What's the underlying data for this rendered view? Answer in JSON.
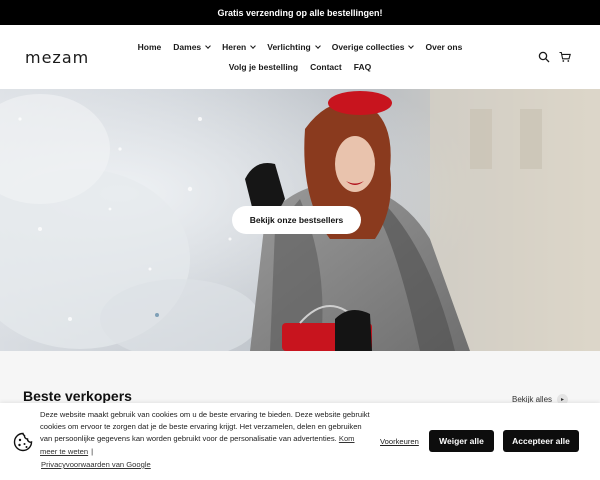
{
  "announcement": "Gratis verzending op alle bestellingen!",
  "header": {
    "logo": "mezam",
    "nav_row1": [
      {
        "label": "Home",
        "has_chevron": false
      },
      {
        "label": "Dames",
        "has_chevron": true
      },
      {
        "label": "Heren",
        "has_chevron": true
      },
      {
        "label": "Verlichting",
        "has_chevron": true
      },
      {
        "label": "Overige collecties",
        "has_chevron": true
      },
      {
        "label": "Over ons",
        "has_chevron": false
      }
    ],
    "nav_row2": [
      {
        "label": "Volg je bestelling"
      },
      {
        "label": "Contact"
      },
      {
        "label": "FAQ"
      }
    ],
    "icons": [
      "search-icon",
      "cart-icon"
    ]
  },
  "hero": {
    "cta_label": "Bekijk onze bestsellers"
  },
  "bestsellers": {
    "title": "Beste verkopers",
    "view_all": "Bekijk alles"
  },
  "cookie": {
    "text": "Deze website maakt gebruik van cookies om u de beste ervaring te bieden. Deze website gebruikt cookies om ervoor te zorgen dat je de beste ervaring krijgt. Het verzamelen, delen en gebruiken van persoonlijke gegevens kan worden gebruikt voor de personalisatie van advertenties.",
    "learn_more": "Kom meer te weten",
    "separator": "|",
    "privacy_link": "Privacyvoorwaarden van Google",
    "preferences": "Voorkeuren",
    "reject": "Weiger alle",
    "accept": "Accepteer alle"
  },
  "colors": {
    "announcement_bg": "#000000",
    "button_dark": "#0d0d0d",
    "band_bg": "#f6f6f6",
    "accent_red": "#c8141e"
  }
}
